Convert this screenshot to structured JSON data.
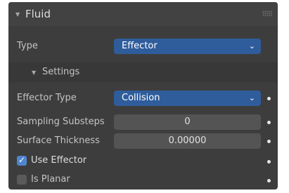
{
  "panel": {
    "title": "Fluid",
    "type_label": "Type",
    "type_value": "Effector",
    "settings_title": "Settings",
    "effector_type_label": "Effector Type",
    "effector_type_value": "Collision",
    "sampling_substeps_label": "Sampling Substeps",
    "sampling_substeps_value": "0",
    "surface_thickness_label": "Surface Thickness",
    "surface_thickness_value": "0.00000",
    "use_effector_label": "Use Effector",
    "use_effector_checked": true,
    "is_planar_label": "Is Planar",
    "is_planar_checked": false
  },
  "icons": {
    "collapse": "triangle-down-icon",
    "dropdown": "chevron-down-icon",
    "grip": "drag-grip-icon",
    "keyframe": "keyframe-dot-icon",
    "check": "checkmark-icon"
  },
  "colors": {
    "panel_bg": "#3d3d3d",
    "dropdown_bg": "#2f5d9c",
    "field_bg": "#545454",
    "checkbox_on": "#4f86cf"
  }
}
